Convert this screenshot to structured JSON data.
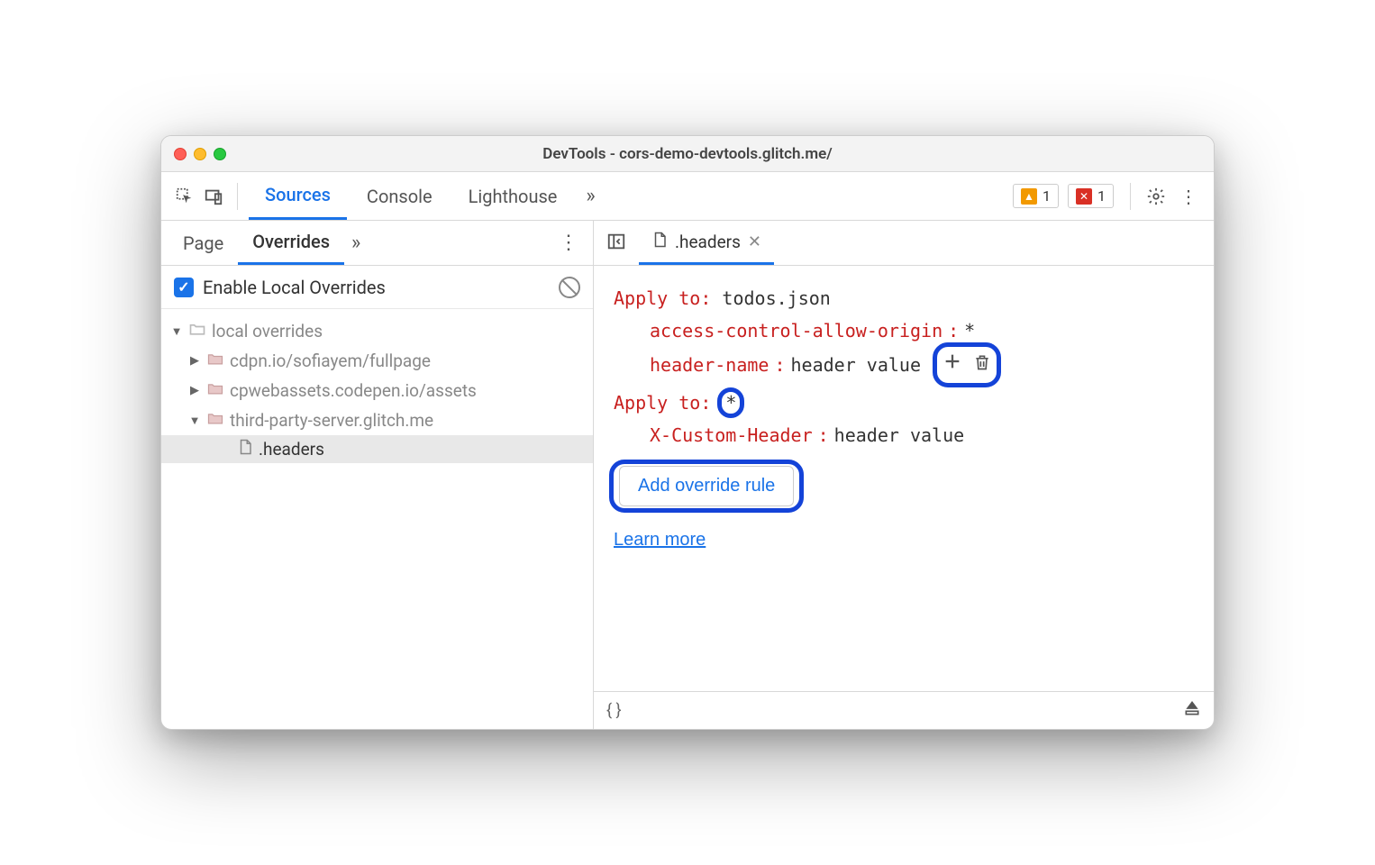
{
  "window": {
    "title": "DevTools - cors-demo-devtools.glitch.me/"
  },
  "toolbar": {
    "tabs": [
      "Sources",
      "Console",
      "Lighthouse"
    ],
    "active_tab": "Sources",
    "warnings_count": "1",
    "errors_count": "1"
  },
  "sidebar": {
    "subtabs": [
      "Page",
      "Overrides"
    ],
    "active_subtab": "Overrides",
    "enable_label": "Enable Local Overrides",
    "tree": [
      {
        "label": "local overrides",
        "level": 0,
        "expanded": true,
        "type": "folder-open",
        "dim": true
      },
      {
        "label": "cdpn.io/sofiayem/fullpage",
        "level": 1,
        "expanded": false,
        "type": "folder"
      },
      {
        "label": "cpwebassets.codepen.io/assets",
        "level": 1,
        "expanded": false,
        "type": "folder"
      },
      {
        "label": "third-party-server.glitch.me",
        "level": 1,
        "expanded": true,
        "type": "folder"
      },
      {
        "label": ".headers",
        "level": 2,
        "type": "file",
        "selected": true
      }
    ]
  },
  "editor": {
    "open_file": ".headers",
    "apply_to_label": "Apply to",
    "rules": [
      {
        "target": "todos.json",
        "headers": [
          {
            "name": "access-control-allow-origin",
            "value": "*"
          },
          {
            "name": "header-name",
            "value": "header value",
            "show_actions": true
          }
        ]
      },
      {
        "target": "*",
        "target_highlight": true,
        "headers": [
          {
            "name": "X-Custom-Header",
            "value": "header value"
          }
        ]
      }
    ],
    "add_rule_label": "Add override rule",
    "learn_more_label": "Learn more"
  },
  "statusbar": {
    "braces": "{ }"
  }
}
